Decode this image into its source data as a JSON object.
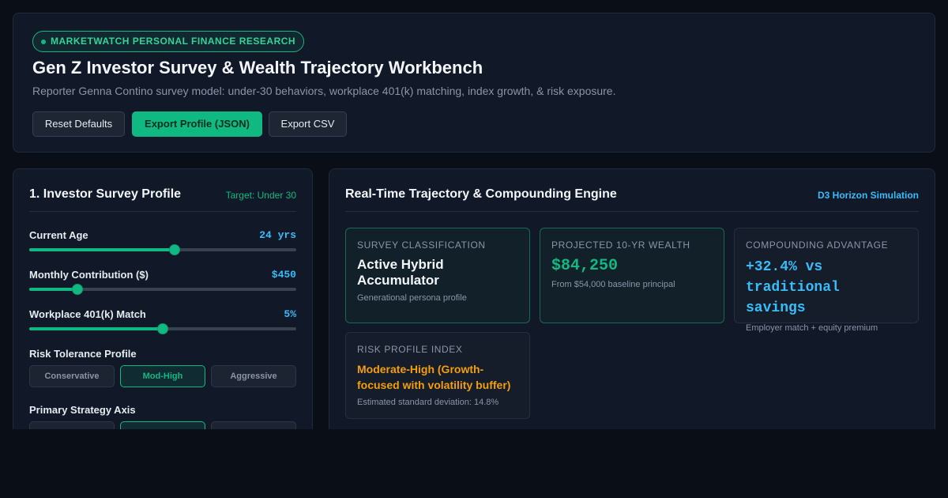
{
  "header": {
    "badge": "MARKETWATCH PERSONAL FINANCE RESEARCH",
    "title": "Gen Z Investor Survey & Wealth Trajectory Workbench",
    "subtitle": "Reporter Genna Contino survey model: under-30 behaviors, workplace 401(k) matching, index growth, & risk exposure.",
    "buttons": {
      "reset": "Reset Defaults",
      "export_json": "Export Profile (JSON)",
      "export_csv": "Export CSV"
    }
  },
  "profile": {
    "title": "1. Investor Survey Profile",
    "target": "Target: Under 30",
    "sliders": [
      {
        "label": "Current Age",
        "value": "24 yrs",
        "level": 0.545
      },
      {
        "label": "Monthly Contribution ($)",
        "value": "$450",
        "level": 0.18
      },
      {
        "label": "Workplace 401(k) Match",
        "value": "5%",
        "level": 0.5
      }
    ],
    "risk": {
      "label": "Risk Tolerance Profile",
      "options": [
        "Conservative",
        "Mod-High",
        "Aggressive"
      ],
      "selected": "Mod-High"
    },
    "strategy": {
      "label": "Primary Strategy Axis"
    }
  },
  "engine": {
    "title": "Real-Time Trajectory & Compounding Engine",
    "tag": "D3 Horizon Simulation",
    "cards": {
      "classification": {
        "kicker": "SURVEY CLASSIFICATION",
        "main": "Active Hybrid Accumulator",
        "note": "Generational persona profile"
      },
      "wealth": {
        "kicker": "PROJECTED 10-YR WEALTH",
        "main": "$84,250",
        "note": "From $54,000 baseline principal"
      },
      "advantage": {
        "kicker": "COMPOUNDING ADVANTAGE",
        "main": "+32.4% vs traditional savings",
        "note": "Employer match + equity premium"
      },
      "risk": {
        "kicker": "RISK PROFILE INDEX",
        "main": "Moderate-High (Growth-focused with volatility buffer)",
        "note": "Estimated standard deviation: 14.8%"
      }
    }
  },
  "colors": {
    "accent": "#10b981",
    "info": "#38bdf8",
    "warning": "#f59e0b",
    "background": "#0a0e16",
    "panel": "#111827"
  }
}
